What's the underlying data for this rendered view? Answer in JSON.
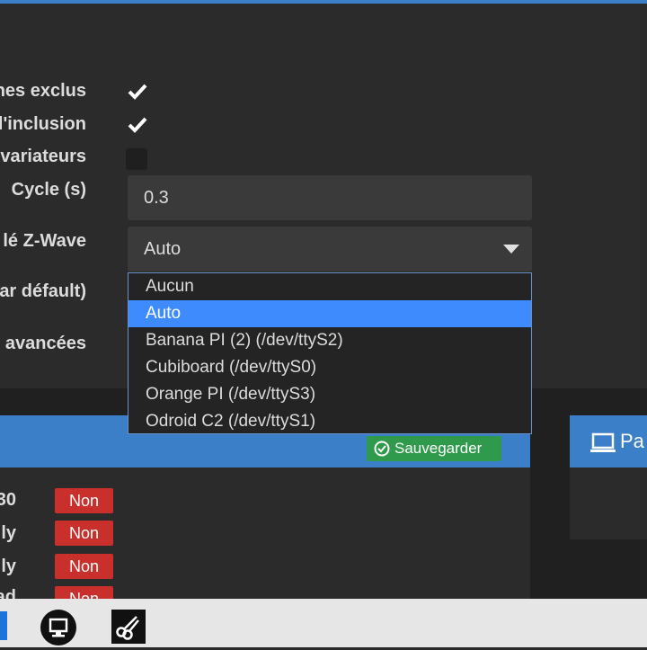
{
  "form": {
    "labels": {
      "excluded": "nes exclus",
      "inclusion": "l'inclusion",
      "dimmers": "variateurs",
      "cycle": "Cycle (s)",
      "zwave_key": "lé Z-Wave",
      "default": "ar défault)",
      "advanced": "avancées"
    },
    "checkboxes": {
      "excluded": true,
      "inclusion": true,
      "dimmers": false
    },
    "cycle_value": "0.3",
    "select_value": "Auto"
  },
  "dropdown": {
    "options": [
      "Aucun",
      "Auto",
      "Banana PI (2) (/dev/ttyS2)",
      "Cubiboard (/dev/ttyS0)",
      "Orange PI (/dev/ttyS3)",
      "Odroid C2 (/dev/ttyS1)"
    ],
    "selected": "Auto"
  },
  "left_panel": {
    "save_label": "Sauvegarder",
    "rows": [
      {
        "label": "30",
        "status": "Non"
      },
      {
        "label": "ly",
        "status": "Non"
      },
      {
        "label": "ly",
        "status": "Non"
      },
      {
        "label": "ad",
        "status": "Non"
      }
    ]
  },
  "right_panel": {
    "title": "Pa"
  },
  "colors": {
    "accent": "#3a7fc7",
    "selected": "#3d8bfd",
    "success": "#2f9a4b",
    "danger": "#c9302c"
  },
  "taskbar": {
    "icons": [
      "start-icon",
      "computer-icon",
      "scissors-icon"
    ]
  }
}
